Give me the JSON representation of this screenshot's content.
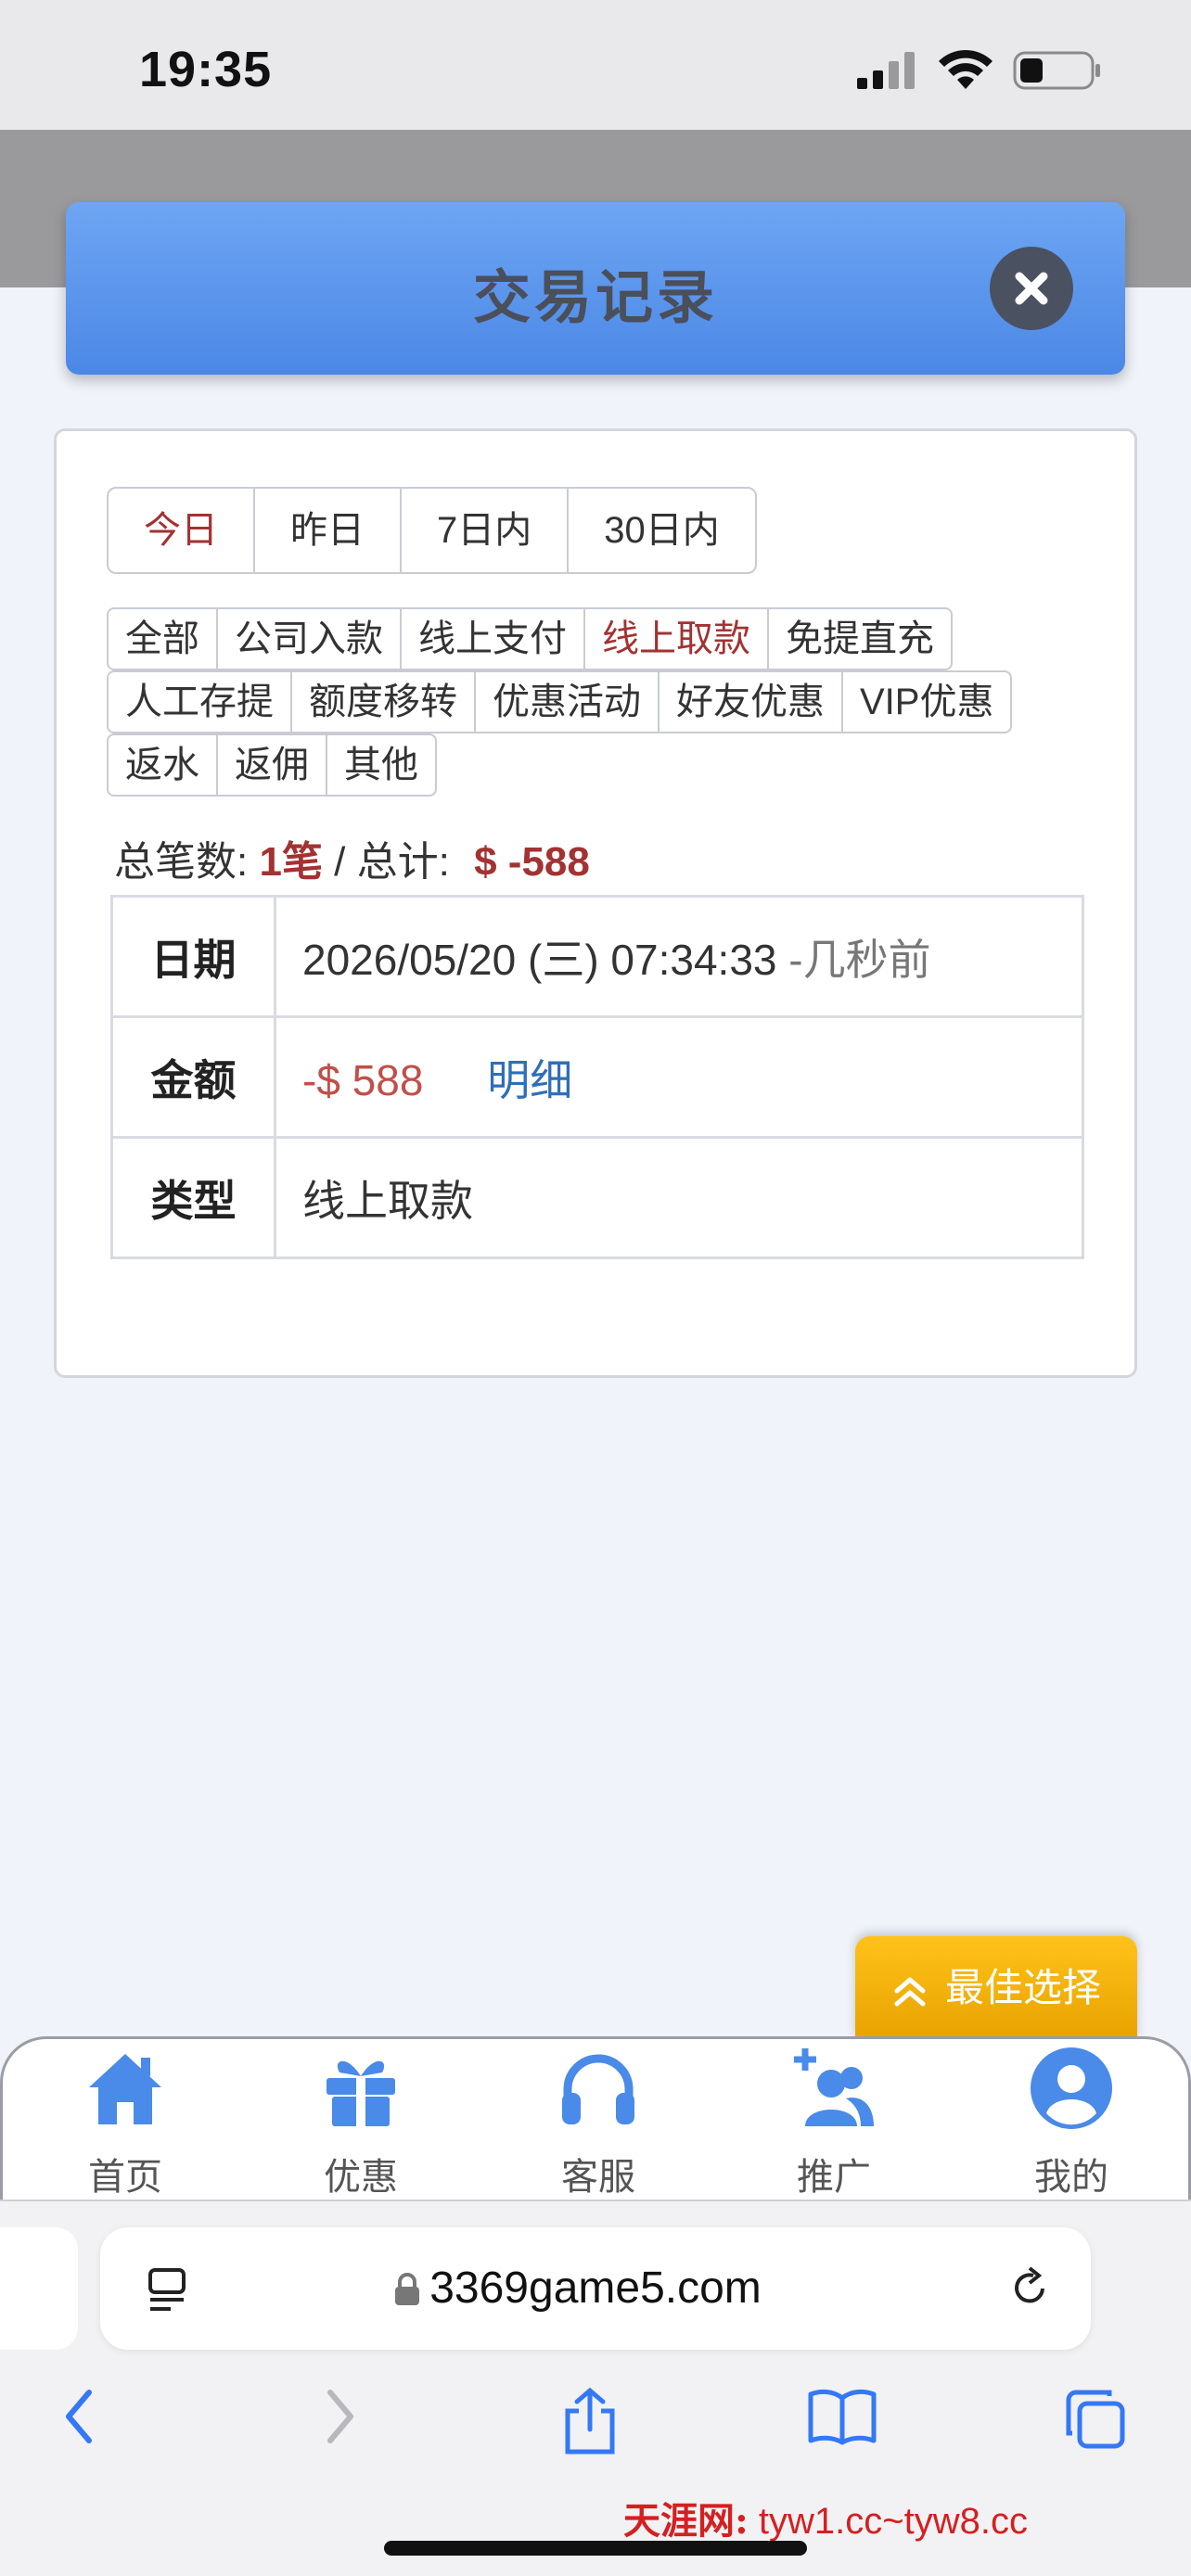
{
  "status_bar": {
    "time": "19:35"
  },
  "header": {
    "title": "交易记录"
  },
  "date_tabs": [
    {
      "label": "今日",
      "active": true
    },
    {
      "label": "昨日",
      "active": false
    },
    {
      "label": "7日内",
      "active": false
    },
    {
      "label": "30日内",
      "active": false
    }
  ],
  "filters": {
    "row1": [
      {
        "label": "全部",
        "active": false
      },
      {
        "label": "公司入款",
        "active": false
      },
      {
        "label": "线上支付",
        "active": false
      },
      {
        "label": "线上取款",
        "active": true
      },
      {
        "label": "免提直充",
        "active": false
      }
    ],
    "row2": [
      {
        "label": "人工存提"
      },
      {
        "label": "额度移转"
      },
      {
        "label": "优惠活动"
      },
      {
        "label": "好友优惠"
      },
      {
        "label": "VIP优惠"
      }
    ],
    "row3": [
      {
        "label": "返水"
      },
      {
        "label": "返佣"
      },
      {
        "label": "其他"
      }
    ]
  },
  "summary": {
    "count_label": "总笔数:",
    "count_value": "1笔",
    "separator": " / ",
    "total_label": "总计:",
    "total_value": "$ -588"
  },
  "record": {
    "date_label": "日期",
    "date_value": "2026/05/20 (三) 07:34:33",
    "date_relative": "-几秒前",
    "amount_label": "金额",
    "amount_value": "-$ 588",
    "detail_link": "明细",
    "type_label": "类型",
    "type_value": "线上取款"
  },
  "best_choice": {
    "label": "最佳选择"
  },
  "bottom_nav": [
    {
      "label": "首页",
      "icon": "home-icon"
    },
    {
      "label": "优惠",
      "icon": "gift-icon"
    },
    {
      "label": "客服",
      "icon": "headphones-icon"
    },
    {
      "label": "推广",
      "icon": "add-user-icon"
    },
    {
      "label": "我的",
      "icon": "user-icon"
    }
  ],
  "browser": {
    "url": "3369game5.com"
  },
  "watermark": {
    "cn": "天涯网:",
    "url": "tyw1.cc~tyw8.cc"
  },
  "colors": {
    "accent_red": "#a33232",
    "header_blue": "#4b87e6",
    "nav_blue": "#4a8ae8",
    "best_gold": "#f2b200"
  }
}
